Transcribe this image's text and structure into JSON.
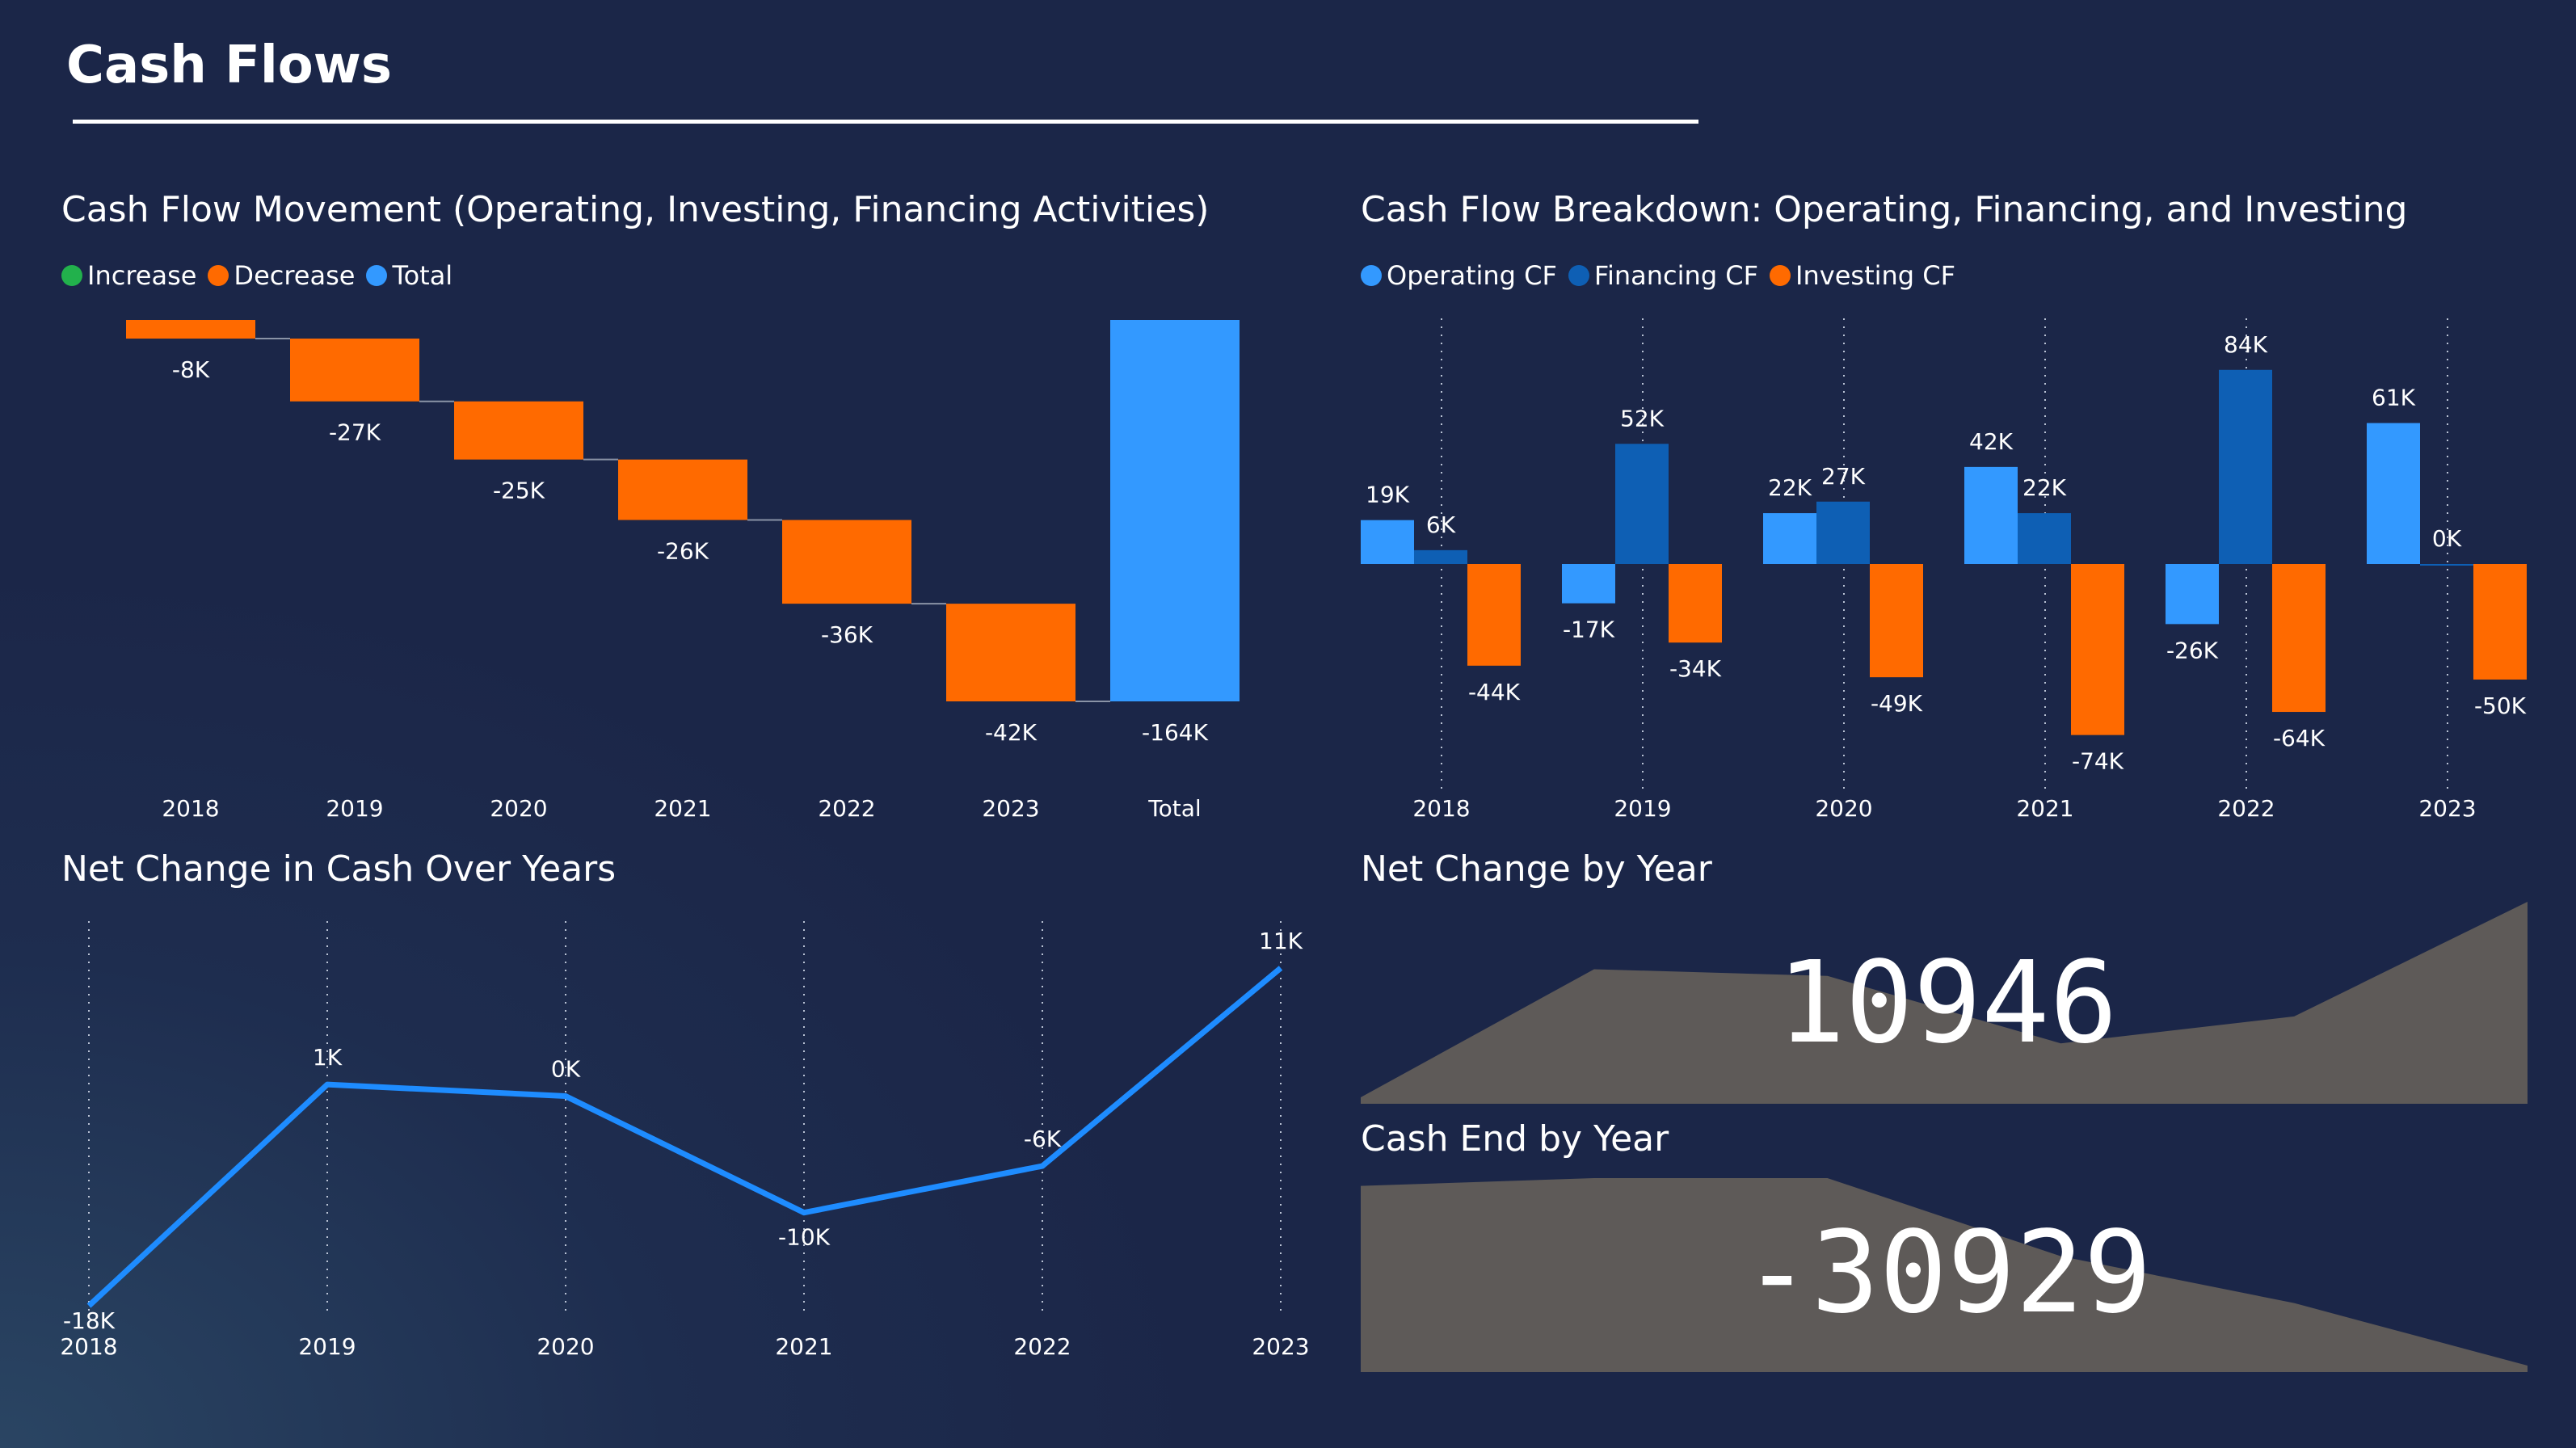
{
  "page": {
    "title": "Cash Flows"
  },
  "colors": {
    "increase": "#22b14c",
    "decrease": "#ff6a00",
    "total": "#3399ff",
    "operating": "#3399ff",
    "financing": "#0e5fb4",
    "investing": "#ff6a00",
    "line": "#1e8cff",
    "area": "#5e5a58",
    "tick": "#ffffff"
  },
  "waterfall": {
    "title": "Cash Flow Movement (Operating, Investing, Financing Activities)",
    "legend": [
      {
        "label": "Increase",
        "color_key": "increase"
      },
      {
        "label": "Decrease",
        "color_key": "decrease"
      },
      {
        "label": "Total",
        "color_key": "total"
      }
    ]
  },
  "breakdown": {
    "title": "Cash Flow Breakdown: Operating, Financing, and Investing",
    "legend": [
      {
        "label": "Operating CF",
        "color_key": "operating"
      },
      {
        "label": "Financing CF",
        "color_key": "financing"
      },
      {
        "label": "Investing CF",
        "color_key": "investing"
      }
    ]
  },
  "net_change_line": {
    "title": "Net Change in Cash Over Years"
  },
  "kpi_net_change": {
    "title": "Net Change by Year",
    "value": "10946"
  },
  "kpi_cash_end": {
    "title": "Cash End by Year",
    "value": "-30929"
  },
  "chart_data": [
    {
      "id": "waterfall",
      "type": "bar",
      "subtype": "waterfall",
      "title": "Cash Flow Movement (Operating, Investing, Financing Activities)",
      "categories": [
        "2018",
        "2019",
        "2020",
        "2021",
        "2022",
        "2023",
        "Total"
      ],
      "values": [
        -8,
        -27,
        -25,
        -26,
        -36,
        -42,
        -164
      ],
      "labels": [
        "-8K",
        "-27K",
        "-25K",
        "-26K",
        "-36K",
        "-42K",
        "-164K"
      ],
      "units": "K",
      "legend": [
        "Increase",
        "Decrease",
        "Total"
      ],
      "legend_position": "top-left"
    },
    {
      "id": "breakdown",
      "type": "bar",
      "title": "Cash Flow Breakdown: Operating, Financing, and Investing",
      "categories": [
        "2018",
        "2019",
        "2020",
        "2021",
        "2022",
        "2023"
      ],
      "series": [
        {
          "name": "Operating CF",
          "values": [
            19,
            -17,
            22,
            42,
            -26,
            61
          ],
          "labels": [
            "19K",
            "-17K",
            "22K",
            "42K",
            "-26K",
            "61K"
          ]
        },
        {
          "name": "Financing CF",
          "values": [
            6,
            52,
            27,
            22,
            84,
            0
          ],
          "labels": [
            "6K",
            "52K",
            "27K",
            "22K",
            "84K",
            "0K"
          ]
        },
        {
          "name": "Investing CF",
          "values": [
            -44,
            -34,
            -49,
            -74,
            -64,
            -50
          ],
          "labels": [
            "-44K",
            "-34K",
            "-49K",
            "-74K",
            "-64K",
            "-50K"
          ]
        }
      ],
      "units": "K",
      "legend_position": "top-left",
      "grid": "vertical dotted"
    },
    {
      "id": "net_change_line",
      "type": "line",
      "title": "Net Change in Cash Over Years",
      "x": [
        "2018",
        "2019",
        "2020",
        "2021",
        "2022",
        "2023"
      ],
      "y": [
        -18,
        1,
        0,
        -10,
        -6,
        11
      ],
      "labels": [
        "-18K",
        "1K",
        "0K",
        "-10K",
        "-6K",
        "11K"
      ],
      "units": "K",
      "grid": "vertical dotted"
    },
    {
      "id": "net_change_area",
      "type": "area",
      "title": "Net Change by Year",
      "x": [
        "2018",
        "2019",
        "2020",
        "2021",
        "2022",
        "2023"
      ],
      "y": [
        -18,
        1,
        0,
        -10,
        -6,
        11
      ],
      "axes": "hidden"
    },
    {
      "id": "cash_end_area",
      "type": "area",
      "title": "Cash End by Year",
      "x": [
        "2018",
        "2019",
        "2020",
        "2021",
        "2022",
        "2023"
      ],
      "y": [
        -8,
        -7,
        -7,
        -17,
        -23,
        -31
      ],
      "axes": "hidden"
    }
  ]
}
